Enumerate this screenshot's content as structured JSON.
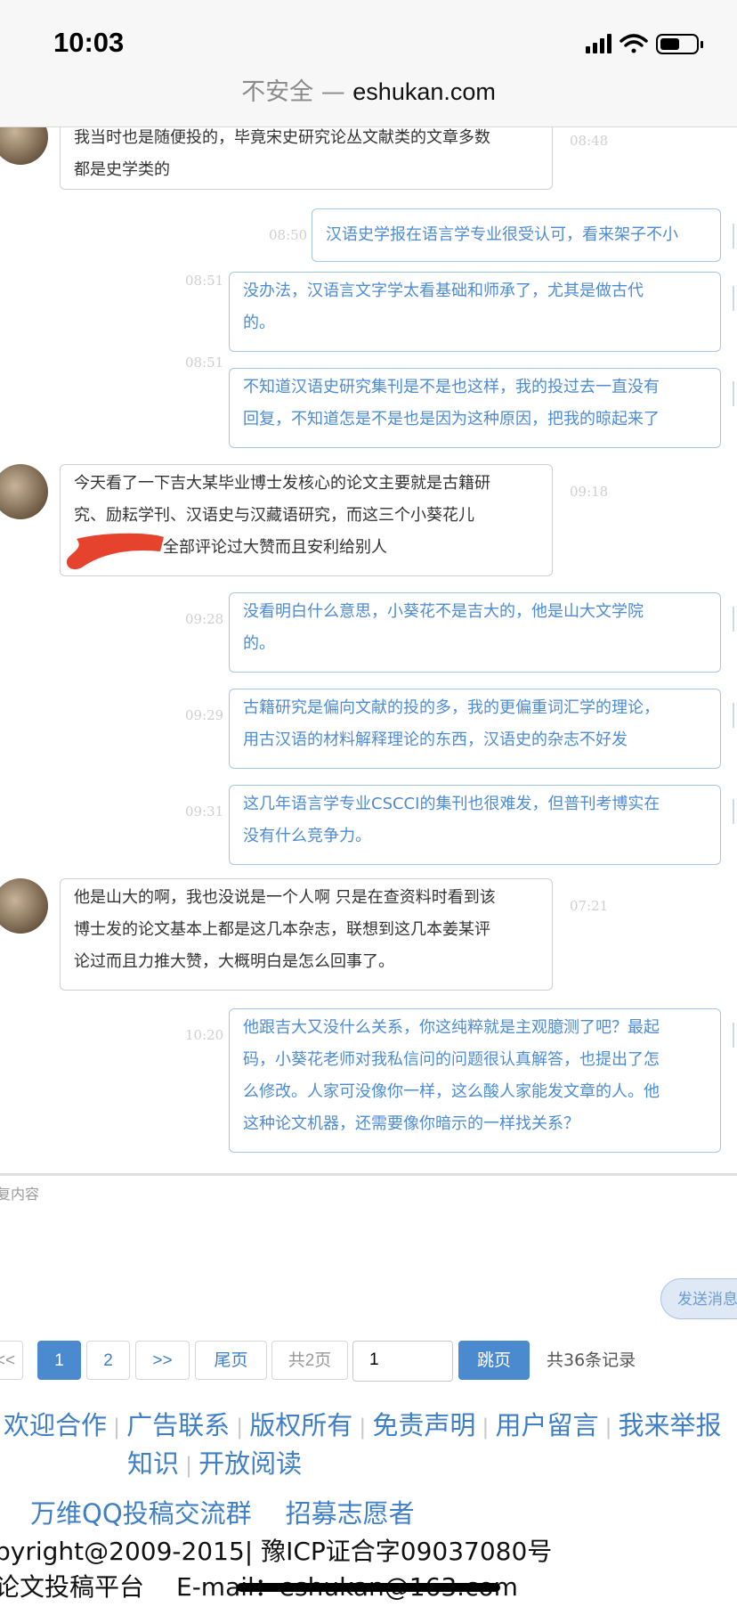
{
  "status_bar": {
    "time": "10:03",
    "battery_level": 0.55
  },
  "url_bar": {
    "security_label": "不安全 — ",
    "domain": "eshukan.com"
  },
  "messages": [
    {
      "side": "other",
      "time": "08:48",
      "lines": [
        "我当时也是随便投的，毕竟宋史研究论丛文献类的文章多数",
        "都是史学类的"
      ]
    },
    {
      "side": "me",
      "time": "08:50",
      "lines": [
        "汉语史学报在语言学专业很受认可，看来架子不小"
      ]
    },
    {
      "side": "me",
      "time": "08:51",
      "lines": [
        "没办法，汉语言文字学太看基础和师承了，尤其是做古代",
        "的。"
      ]
    },
    {
      "side": "me",
      "time": "08:51",
      "lines": [
        "不知道汉语史研究集刊是不是也这样，我的投过去一直没有",
        "回复，不知道怎是不是也是因为这种原因，把我的晾起来了"
      ]
    },
    {
      "side": "other",
      "time": "09:18",
      "lines": [
        "今天看了一下吉大某毕业博士发核心的论文主要就是古籍研",
        "究、励耘学刊、汉语史与汉藏语研究，而这三个小葵花儿",
        "全部评论过大赞而且安利给别人"
      ]
    },
    {
      "side": "me",
      "time": "09:28",
      "lines": [
        "没看明白什么意思，小葵花不是吉大的，他是山大文学院",
        "的。"
      ]
    },
    {
      "side": "me",
      "time": "09:29",
      "lines": [
        "古籍研究是偏向文献的投的多，我的更偏重词汇学的理论，",
        "用古汉语的材料解释理论的东西，汉语史的杂志不好发"
      ]
    },
    {
      "side": "me",
      "time": "09:31",
      "lines": [
        "这几年语言学专业CSCCI的集刊也很难发，但普刊考博实在",
        "没有什么竞争力。"
      ]
    },
    {
      "side": "other",
      "time": "07:21",
      "lines": [
        "他是山大的啊，我也没说是一个人啊 只是在查资料时看到该",
        "博士发的论文基本上都是这几本杂志，联想到这几本姜某评",
        "论过而且力推大赞，大概明白是怎么回事了。"
      ]
    },
    {
      "side": "me",
      "time": "10:20",
      "lines": [
        "他跟吉大又没什么关系，你这纯粹就是主观臆测了吧？最起",
        "码，小葵花老师对我私信问的问题很认真解答，也提出了怎",
        "么修改。人家可没像你一样，这么酸人家能发文章的人。他",
        "这种论文机器，还需要像你暗示的一样找关系？"
      ]
    }
  ],
  "reply": {
    "placeholder": "复内容",
    "send_label": "发送消息"
  },
  "pagination": {
    "prev": "<<",
    "page1": "1",
    "page2": "2",
    "next": ">>",
    "last": "尾页",
    "total_pages": "共2页",
    "jump_value": "1",
    "jump": "跳页",
    "total_records": "共36条记录"
  },
  "footer": {
    "links_row1": [
      "欢迎合作",
      "广告联系",
      "版权所有",
      "免责声明",
      "用户留言",
      "我来举报"
    ],
    "links_row2": [
      "知识",
      "开放阅读"
    ],
    "qq_group": "万维QQ投稿交流群",
    "volunteer": "招募志愿者",
    "copyright": "pyright@2009-2015| 豫ICP证合字09037080号",
    "platform": "论文投稿平台",
    "email": "E-mail：eshukan@163.com"
  },
  "colors": {
    "accent": "#4c8ad0",
    "my_text": "#4d8bd2",
    "my_border": "#a6c6ea"
  }
}
